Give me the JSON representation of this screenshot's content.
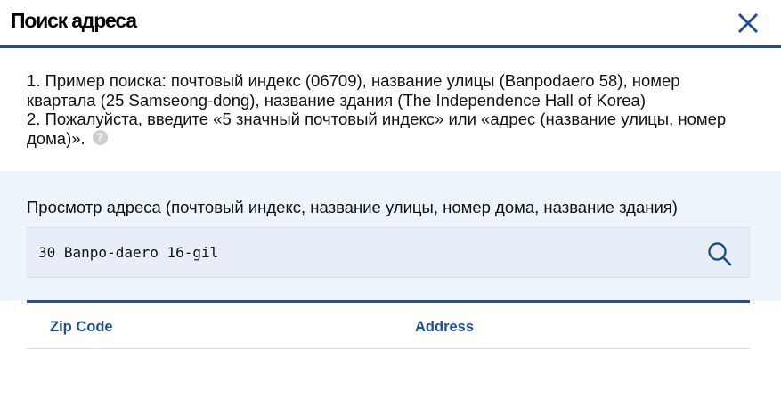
{
  "header": {
    "title": "Поиск адреса",
    "close_icon": "close-icon"
  },
  "notes": {
    "line1": "1. Пример поиска: почтовый индекс (06709), название улицы (Banpodaero 58), номер квартала (25 Samseong-dong), название здания (The Independence Hall of Korea)",
    "line2": "2. Пожалуйста, введите «5 значный почтовый индекс» или «адрес (название улицы, номер дома)».",
    "help_icon": "question-icon"
  },
  "search": {
    "label": "Просмотр адреса (почтовый индекс, название улицы, номер дома, название здания)",
    "value": "30 Banpo-daero 16-gil",
    "icon": "search-icon"
  },
  "results": {
    "columns": [
      "Zip Code",
      "Address"
    ]
  },
  "colors": {
    "accent": "#1f4f8f",
    "search_bg": "#eef4fb",
    "input_bg": "#e7eef7"
  }
}
